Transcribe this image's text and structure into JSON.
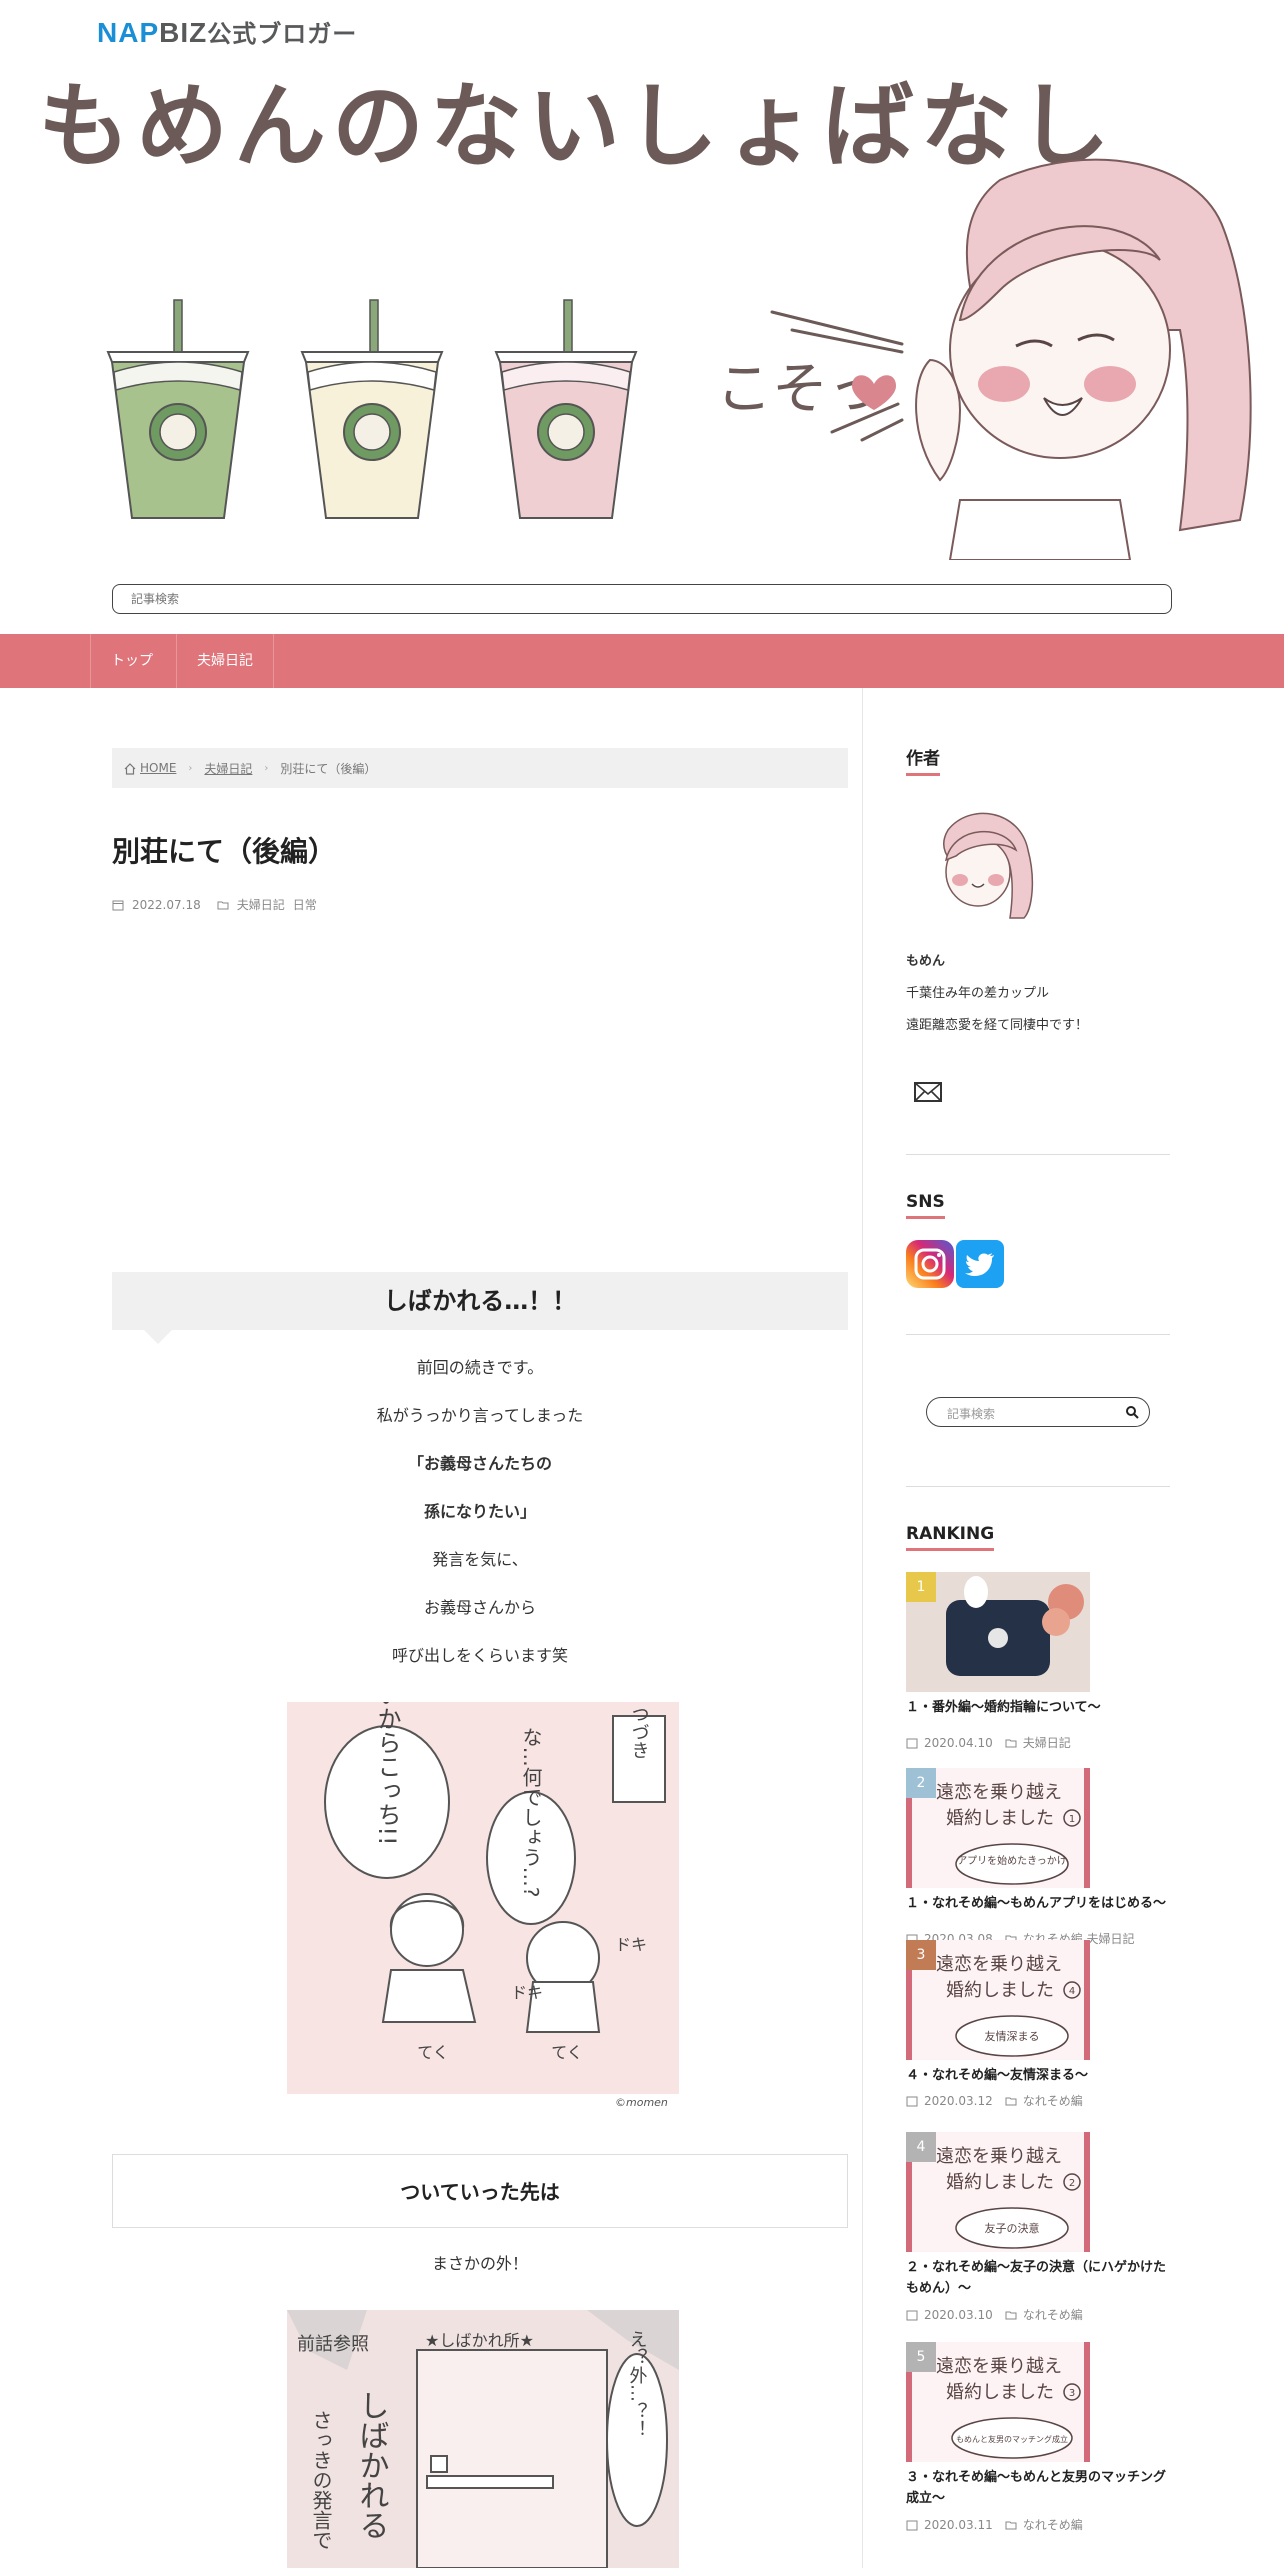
{
  "header": {
    "badge_nap": "NAP",
    "badge_biz": "BIZ",
    "badge_rest": "公式ブロガー",
    "site_title": "もめんのないしょばなし",
    "speech_text": "こそっ",
    "search_placeholder": "記事検索"
  },
  "nav": {
    "items": [
      {
        "label": "トップ"
      },
      {
        "label": "夫婦日記"
      }
    ]
  },
  "breadcrumb": {
    "home": "HOME",
    "category": "夫婦日記",
    "current": "別荘にて（後編）"
  },
  "post": {
    "title": "別荘にて（後編）",
    "date": "2022.07.18",
    "categories": [
      "夫婦日記",
      "日常"
    ],
    "heading1": "しばかれる…！！",
    "paragraphs": [
      {
        "text": "前回の続きです。",
        "bold": false
      },
      {
        "text": "私がうっかり言ってしまった",
        "bold": false
      },
      {
        "text": "「お義母さんたちの",
        "bold": true
      },
      {
        "text": "孫になりたい」",
        "bold": true
      },
      {
        "text": "発言を気に、",
        "bold": false
      },
      {
        "text": "お義母さんから",
        "bold": false
      },
      {
        "text": "呼び出しをくらいます笑",
        "bold": false
      }
    ],
    "image1": {
      "tag": "つづき",
      "bubble1": "いいからこっち!!",
      "bubble2": "な…何でしょう…?",
      "sfx1": "ドキ",
      "sfx2": "ドキ",
      "walk1": "てく",
      "walk2": "てく",
      "copyright": "©momen"
    },
    "heading2": "ついていった先は",
    "para2": "まさかの外！",
    "image2": {
      "label_left": "前話参照",
      "sign": "★しばかれ所★",
      "vertical_left": "さっきの発言で",
      "vertical_center": "しばかれる",
      "vertical_right": "え？外…？！"
    }
  },
  "sidebar": {
    "author_title": "作者",
    "author_name": "もめん",
    "author_desc1": "千葉住み年の差カップル",
    "author_desc2": "遠距離恋愛を経て同棲中です！",
    "sns_title": "SNS",
    "search_placeholder": "記事検索",
    "ranking_title": "RANKING",
    "ranking": [
      {
        "num": "1",
        "title": "１・番外編～婚約指輪について～",
        "date": "2020.04.10",
        "cats": "夫婦日記",
        "color": "#e8c84a",
        "thumb": "rings"
      },
      {
        "num": "2",
        "title": "１・なれそめ編～もめんアプリをはじめる～",
        "date": "2020.03.08",
        "cats": "なれそめ編  夫婦日記",
        "color": "#9ec1d6",
        "thumb": "manga",
        "line1": "遠恋を乗り越え",
        "line2": "婚約しました",
        "step": "1",
        "bubble": "アプリを始めたきっかけ"
      },
      {
        "num": "3",
        "title": "４・なれそめ編～友情深まる～",
        "date": "2020.03.12",
        "cats": "なれそめ編",
        "color": "#c27c55",
        "thumb": "manga",
        "line1": "遠恋を乗り越え",
        "line2": "婚約しました",
        "step": "4",
        "bubble": "友情深まる"
      },
      {
        "num": "4",
        "title": "２・なれそめ編～友子の決意（にハゲかけたもめん）～",
        "date": "2020.03.10",
        "cats": "なれそめ編",
        "color": "#b3b3b3",
        "thumb": "manga",
        "line1": "遠恋を乗り越え",
        "line2": "婚約しました",
        "step": "2",
        "bubble": "友子の決意"
      },
      {
        "num": "5",
        "title": "３・なれそめ編～もめんと友男のマッチング成立～",
        "date": "2020.03.11",
        "cats": "なれそめ編",
        "color": "#b3b3b3",
        "thumb": "manga",
        "line1": "遠恋を乗り越え",
        "line2": "婚約しました",
        "step": "3",
        "bubble": "もめんと友男のマッチング成立"
      }
    ]
  },
  "colors": {
    "accent": "#df757b",
    "title_brown": "#6b5a57",
    "nap_blue": "#1a8fd6"
  },
  "icons": [
    "home-icon",
    "calendar-icon",
    "folder-icon",
    "mail-icon",
    "instagram-icon",
    "twitter-icon",
    "search-icon"
  ]
}
